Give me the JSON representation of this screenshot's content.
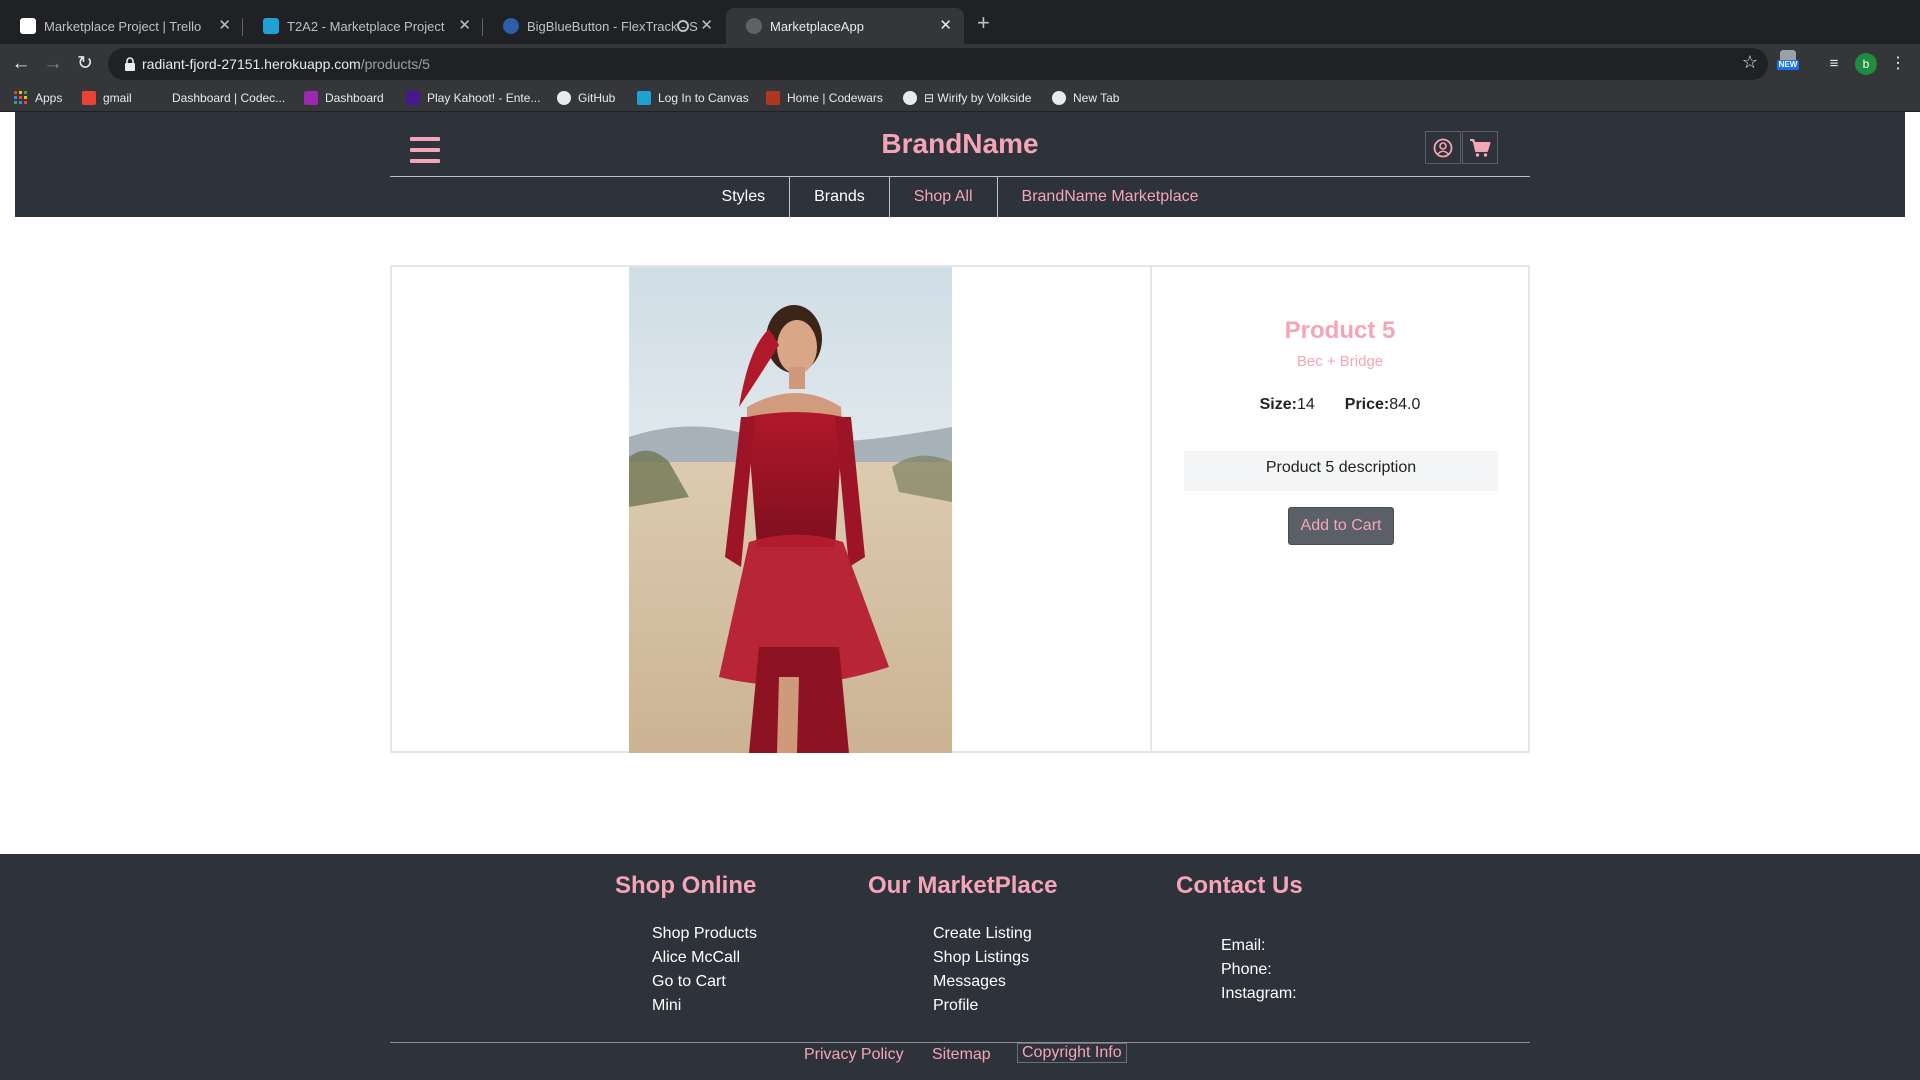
{
  "browser": {
    "tabs": [
      {
        "title": "Marketplace Project | Trello",
        "active": false
      },
      {
        "title": "T2A2 - Marketplace Project",
        "active": false
      },
      {
        "title": "BigBlueButton - FlexTrack - S",
        "active": false
      },
      {
        "title": "MarketplaceApp",
        "active": true
      }
    ],
    "new_tab_icon": "plus-icon",
    "url_host": "radiant-fjord-27151.herokuapp.com",
    "url_path": "/products/5",
    "extension_badge": "NEW",
    "profile_initial": "b",
    "bookmarks": [
      {
        "label": "Apps",
        "icon": "apps-grid-icon"
      },
      {
        "label": "gmail",
        "icon": "gmail-icon"
      },
      {
        "label": "Dashboard | Codec...",
        "icon": "codecademy-icon"
      },
      {
        "label": "Dashboard",
        "icon": "ed-icon"
      },
      {
        "label": "Play Kahoot! - Ente...",
        "icon": "kahoot-icon"
      },
      {
        "label": "GitHub",
        "icon": "github-icon"
      },
      {
        "label": "Log In to Canvas",
        "icon": "canvas-icon"
      },
      {
        "label": "Home | Codewars",
        "icon": "codewars-icon"
      },
      {
        "label": "⊟ Wirify by Volkside",
        "icon": "globe-icon"
      },
      {
        "label": "New Tab",
        "icon": "globe-icon"
      }
    ]
  },
  "header": {
    "brand": "BrandName",
    "nav": [
      {
        "label": "Styles",
        "color": "white"
      },
      {
        "label": "Brands",
        "color": "white"
      },
      {
        "label": "Shop All",
        "color": "pink"
      },
      {
        "label": "BrandName Marketplace",
        "color": "pink"
      }
    ]
  },
  "product": {
    "title": "Product 5",
    "brand": "Bec + Bridge",
    "size_label": "Size:",
    "size_value": "14",
    "price_label": "Price:",
    "price_value": "84.0",
    "description": "Product 5 description",
    "add_to_cart": "Add to Cart"
  },
  "footer": {
    "shop_online": {
      "title": "Shop Online",
      "links": [
        "Shop Products",
        "Alice McCall",
        "Go to Cart",
        "Mini"
      ]
    },
    "our_marketplace": {
      "title": "Our MarketPlace",
      "links": [
        "Create Listing",
        "Shop Listings",
        "Messages",
        "Profile"
      ]
    },
    "contact_us": {
      "title": "Contact Us",
      "lines": [
        "Email:",
        "Phone:",
        "Instagram:"
      ]
    },
    "bottom": {
      "privacy": "Privacy Policy",
      "sitemap": "Sitemap",
      "copyright": "Copyright Info"
    }
  },
  "colors": {
    "accent_pink": "#f5a5b8",
    "header_bg": "#2e323a",
    "button_bg": "#5b6068"
  }
}
